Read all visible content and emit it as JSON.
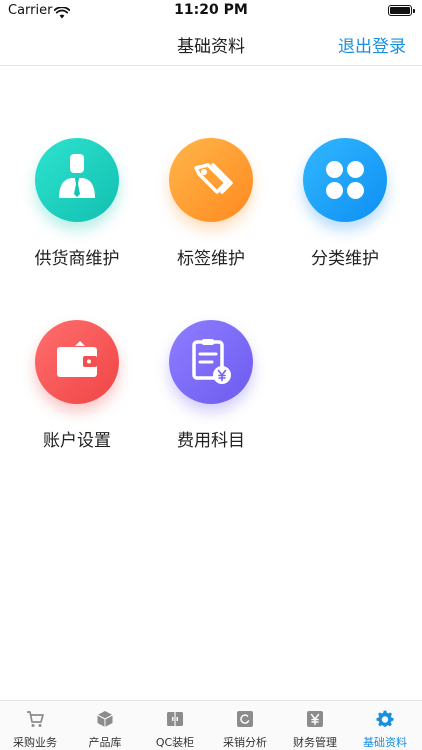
{
  "status_bar": {
    "carrier": "Carrier",
    "time": "11:20 PM"
  },
  "nav": {
    "title": "基础资料",
    "right_action": "退出登录"
  },
  "menu": [
    {
      "label": "供货商维护",
      "icon": "supplier-person-icon",
      "color": "#1fcfbf"
    },
    {
      "label": "标签维护",
      "icon": "tag-icon",
      "color": "#ff9d2f"
    },
    {
      "label": "分类维护",
      "icon": "clover-category-icon",
      "color": "#1aa0f8"
    },
    {
      "label": "账户设置",
      "icon": "wallet-icon",
      "color": "#f55a5a"
    },
    {
      "label": "费用科目",
      "icon": "expense-clipboard-icon",
      "color": "#7d6bf5"
    }
  ],
  "tabs": [
    {
      "label": "采购业务",
      "icon": "cart-icon"
    },
    {
      "label": "产品库",
      "icon": "cube-icon"
    },
    {
      "label": "QC装柜",
      "icon": "container-icon"
    },
    {
      "label": "采销分析",
      "icon": "analysis-icon"
    },
    {
      "label": "财务管理",
      "icon": "yen-icon"
    },
    {
      "label": "基础资料",
      "icon": "gear-icon",
      "active": true
    }
  ],
  "colors": {
    "accent": "#1a8fe0",
    "tab_inactive": "#8c8c8c"
  }
}
